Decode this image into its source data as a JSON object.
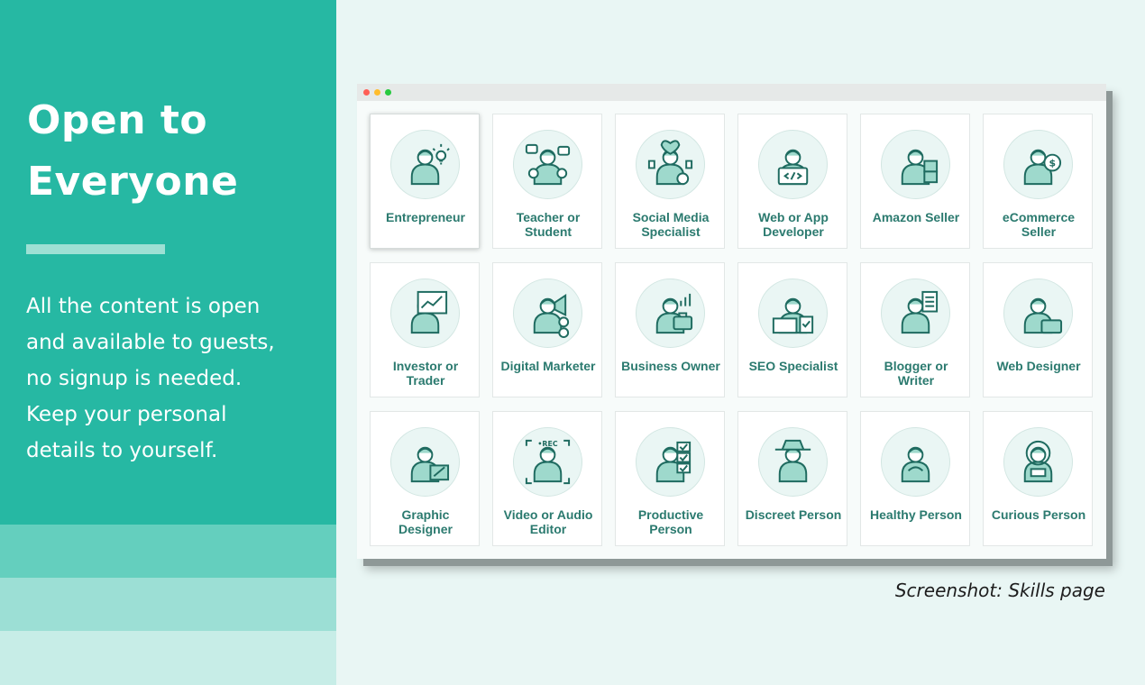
{
  "left_panel": {
    "headline_line1": "Open to",
    "headline_line2": "Everyone",
    "description_lines": [
      "All the content is open",
      "and available to guests,",
      "no signup is needed.",
      "Keep your personal",
      "details to yourself."
    ]
  },
  "colors": {
    "panel": "#26b8a3",
    "accent_text": "#2b7a6f",
    "icon_stroke": "#1f6b60",
    "icon_fill": "#9ed9cc",
    "background": "#e9f6f4"
  },
  "skills": {
    "cards": [
      {
        "lines": [
          "Entrepreneur",
          ""
        ],
        "icon": "lightbulb-person-icon"
      },
      {
        "lines": [
          "Teacher or",
          "Student"
        ],
        "icon": "classroom-icon"
      },
      {
        "lines": [
          "Social Media",
          "Specialist"
        ],
        "icon": "social-likes-icon"
      },
      {
        "lines": [
          "Web or App",
          "Developer"
        ],
        "icon": "laptop-code-icon"
      },
      {
        "lines": [
          "Amazon Seller",
          ""
        ],
        "icon": "seller-boxes-icon"
      },
      {
        "lines": [
          "eCommerce",
          "Seller"
        ],
        "icon": "dollar-coin-icon"
      },
      {
        "lines": [
          "Investor or",
          "Trader"
        ],
        "icon": "stock-chart-icon"
      },
      {
        "lines": [
          "Digital Marketer",
          ""
        ],
        "icon": "megaphone-icon"
      },
      {
        "lines": [
          "Business Owner",
          ""
        ],
        "icon": "briefcase-icon"
      },
      {
        "lines": [
          "SEO Specialist",
          ""
        ],
        "icon": "seo-laptop-icon"
      },
      {
        "lines": [
          "Blogger or",
          "Writer"
        ],
        "icon": "document-icon"
      },
      {
        "lines": [
          "Web Designer",
          ""
        ],
        "icon": "designer-laptop-icon"
      },
      {
        "lines": [
          "Graphic",
          "Designer"
        ],
        "icon": "drawing-board-icon"
      },
      {
        "lines": [
          "Video or Audio",
          "Editor"
        ],
        "icon": "rec-frame-icon"
      },
      {
        "lines": [
          "Productive",
          "Person"
        ],
        "icon": "checklist-icon"
      },
      {
        "lines": [
          "Discreet Person",
          ""
        ],
        "icon": "detective-hat-icon"
      },
      {
        "lines": [
          "Healthy Person",
          ""
        ],
        "icon": "meditation-icon"
      },
      {
        "lines": [
          "Curious Person",
          ""
        ],
        "icon": "astronaut-icon"
      }
    ]
  },
  "caption": "Screenshot: Skills page"
}
